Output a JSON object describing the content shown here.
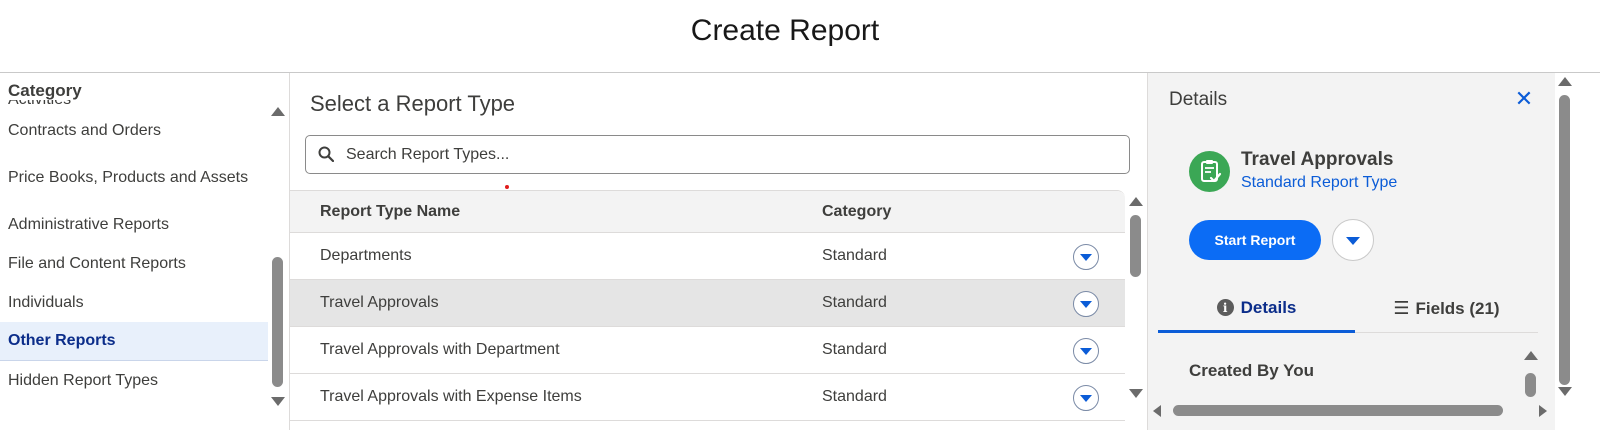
{
  "header": {
    "title": "Create Report"
  },
  "category_panel": {
    "title": "Category",
    "items": [
      {
        "label": "Activities",
        "active": false
      },
      {
        "label": "Contracts and Orders",
        "active": false
      },
      {
        "label": "Price Books, Products and Assets",
        "active": false
      },
      {
        "label": "Administrative Reports",
        "active": false
      },
      {
        "label": "File and Content Reports",
        "active": false
      },
      {
        "label": "Individuals",
        "active": false
      },
      {
        "label": "Other Reports",
        "active": true
      },
      {
        "label": "Hidden Report Types",
        "active": false
      }
    ]
  },
  "main": {
    "title": "Select a Report Type",
    "search": {
      "placeholder": "Search Report Types...",
      "value": ""
    },
    "table": {
      "columns": [
        "Report Type Name",
        "Category"
      ],
      "rows": [
        {
          "name": "Departments",
          "category": "Standard",
          "selected": false
        },
        {
          "name": "Travel Approvals",
          "category": "Standard",
          "selected": true
        },
        {
          "name": "Travel Approvals with Department",
          "category": "Standard",
          "selected": false
        },
        {
          "name": "Travel Approvals with Expense Items",
          "category": "Standard",
          "selected": false
        }
      ]
    }
  },
  "details": {
    "title": "Details",
    "close_icon": "close-icon",
    "report_type": {
      "name": "Travel Approvals",
      "type": "Standard Report Type",
      "icon": "clipboard-check-icon",
      "icon_color": "#3ba755"
    },
    "start_button": "Start Report",
    "tabs": [
      {
        "label": "Details",
        "icon": "info-icon",
        "active": true
      },
      {
        "label": "Fields (21)",
        "icon": "list-icon",
        "active": false
      }
    ],
    "section_heading": "Created By You"
  },
  "colors": {
    "brand_blue": "#0b6cf5",
    "active_nav_bg": "#e8f0fb",
    "active_nav_text": "#0b2d8a"
  }
}
